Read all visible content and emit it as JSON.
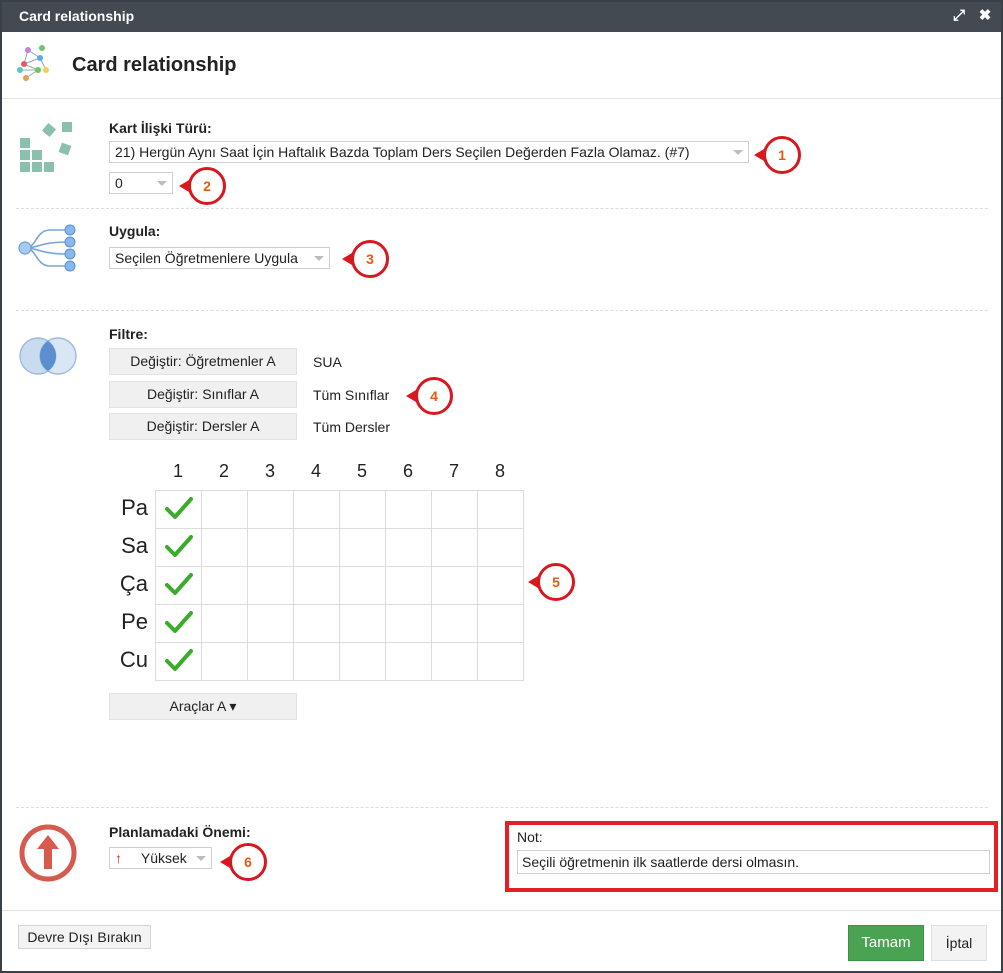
{
  "window": {
    "title": "Card relationship",
    "maximize_glyph": "⤢",
    "close_glyph": "✖"
  },
  "header": {
    "title": "Card relationship",
    "icon": "network-graph-icon"
  },
  "card_type": {
    "label": "Kart İlişki Türü:",
    "selected": "21) Hergün Aynı Saat İçin Haftalık Bazda Toplam Ders Seçilen Değerden Fazla Olamaz. (#7)",
    "value": "0",
    "icon": "blocks-icon"
  },
  "apply": {
    "label": "Uygula:",
    "selected": "Seçilen Öğretmenlere Uygula",
    "icon": "branch-tree-icon"
  },
  "filter": {
    "label": "Filtre:",
    "icon": "venn-circles-icon",
    "rows": [
      {
        "button": "Değiştir: Öğretmenler A",
        "value": "SUA"
      },
      {
        "button": "Değiştir: Sınıflar A",
        "value": "Tüm Sınıflar"
      },
      {
        "button": "Değiştir: Dersler A",
        "value": "Tüm Dersler"
      }
    ]
  },
  "grid": {
    "columns": [
      "1",
      "2",
      "3",
      "4",
      "5",
      "6",
      "7",
      "8"
    ],
    "rows": [
      {
        "day": "Pa",
        "checked": [
          true,
          false,
          false,
          false,
          false,
          false,
          false,
          false
        ]
      },
      {
        "day": "Sa",
        "checked": [
          true,
          false,
          false,
          false,
          false,
          false,
          false,
          false
        ]
      },
      {
        "day": "Ça",
        "checked": [
          true,
          false,
          false,
          false,
          false,
          false,
          false,
          false
        ]
      },
      {
        "day": "Pe",
        "checked": [
          true,
          false,
          false,
          false,
          false,
          false,
          false,
          false
        ]
      },
      {
        "day": "Cu",
        "checked": [
          true,
          false,
          false,
          false,
          false,
          false,
          false,
          false
        ]
      }
    ],
    "tools_button": "Araçlar A ▾"
  },
  "importance": {
    "label": "Planlamadaki Önemi:",
    "selected": "Yüksek",
    "icon": "up-arrow-circle-icon"
  },
  "note": {
    "label": "Not:",
    "value": "Seçili öğretmenin ilk saatlerde dersi olmasın."
  },
  "badges": [
    "1",
    "2",
    "3",
    "4",
    "5",
    "6"
  ],
  "footer": {
    "disable_button": "Devre Dışı Bırakın",
    "ok_button": "Tamam",
    "cancel_button": "İptal"
  },
  "colors": {
    "titlebar": "#434a52",
    "ok_green": "#4aa253",
    "badge_red": "#d9171e",
    "badge_text": "#e65a12",
    "check_green": "#3aab2a"
  }
}
